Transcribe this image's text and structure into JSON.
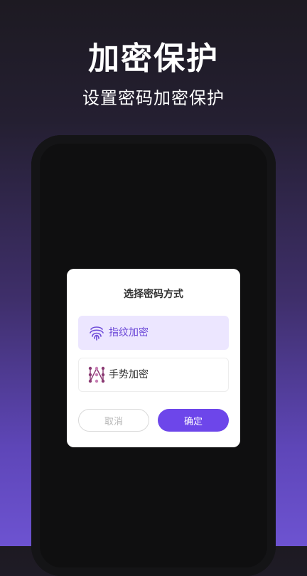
{
  "hero": {
    "title": "加密保护",
    "subtitle": "设置密码加密保护"
  },
  "dialog": {
    "title": "选择密码方式",
    "options": [
      {
        "label": "指纹加密",
        "icon": "fingerprint-icon",
        "selected": true
      },
      {
        "label": "手势加密",
        "icon": "gesture-pattern-icon",
        "selected": false
      }
    ],
    "cancel_label": "取消",
    "confirm_label": "确定"
  },
  "colors": {
    "accent": "#6d46ea",
    "selected_bg": "#ece6ff",
    "selected_text": "#6d4ad8"
  }
}
